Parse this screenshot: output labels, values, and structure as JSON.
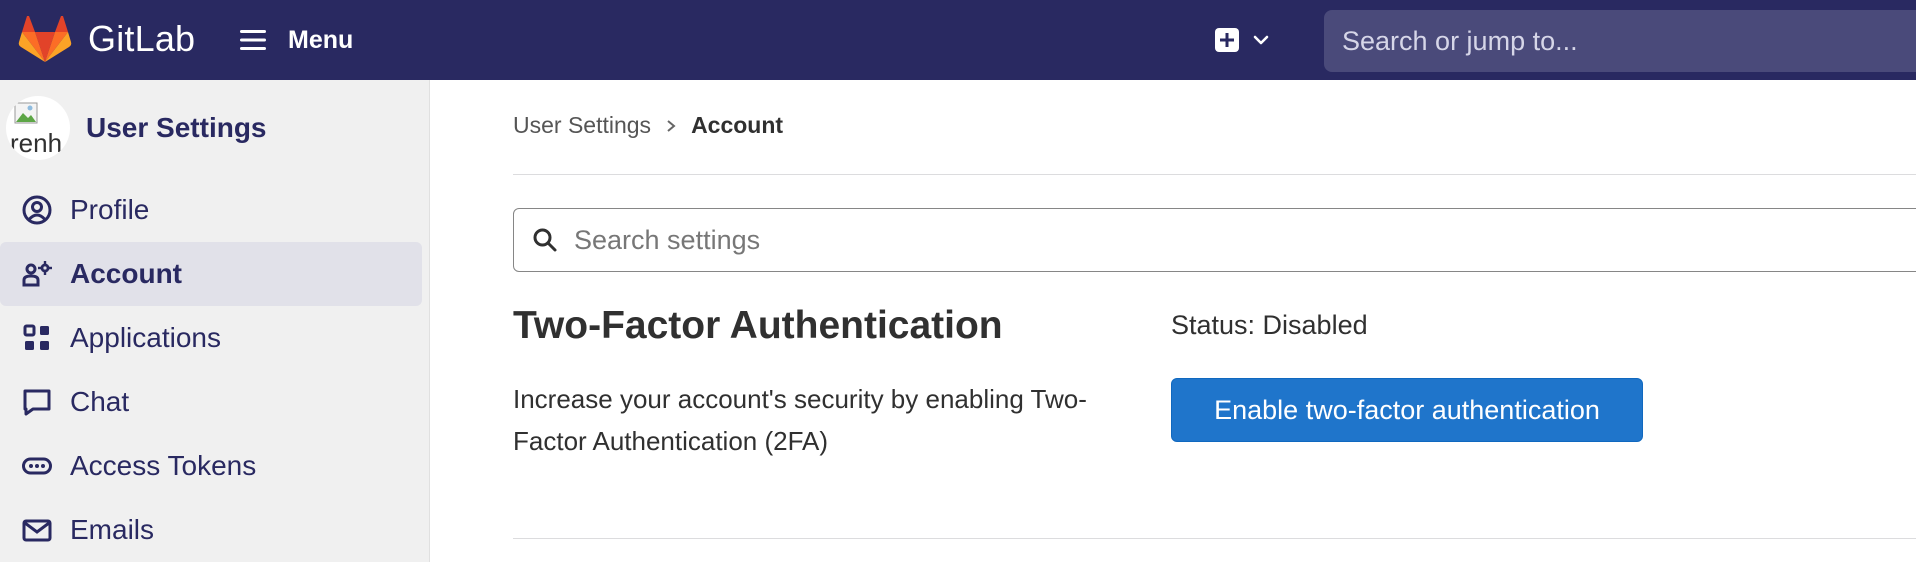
{
  "topbar": {
    "brand": "GitLab",
    "menu_label": "Menu",
    "new_icon": "plus-square-icon",
    "search_placeholder": "Search or jump to...",
    "bg_color": "#292961"
  },
  "sidebar": {
    "context_title": "User Settings",
    "avatar_alt": "renh",
    "items": [
      {
        "label": "Profile",
        "icon": "user-circle-icon",
        "active": false
      },
      {
        "label": "Account",
        "icon": "account-settings-icon",
        "active": true
      },
      {
        "label": "Applications",
        "icon": "applications-icon",
        "active": false
      },
      {
        "label": "Chat",
        "icon": "comment-icon",
        "active": false
      },
      {
        "label": "Access Tokens",
        "icon": "token-icon",
        "active": false
      },
      {
        "label": "Emails",
        "icon": "mail-icon",
        "active": false
      }
    ]
  },
  "breadcrumb": {
    "parent": "User Settings",
    "current": "Account"
  },
  "search_settings": {
    "placeholder": "Search settings"
  },
  "two_factor": {
    "title": "Two-Factor Authentication",
    "description": "Increase your account's security by enabling Two-Factor Authentication (2FA)",
    "status": "Status: Disabled",
    "button_label": "Enable two-factor authentication",
    "button_color": "#1f75cb"
  }
}
